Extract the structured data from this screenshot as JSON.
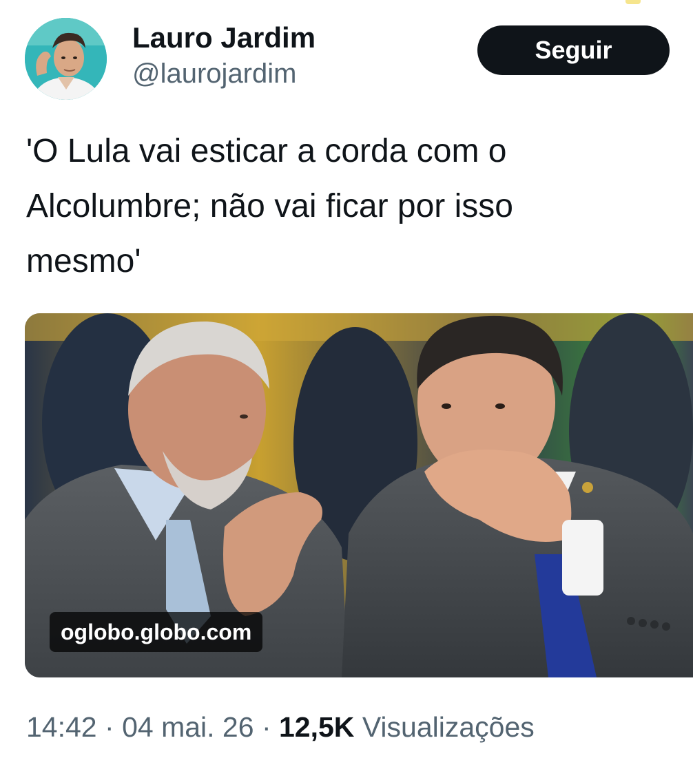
{
  "author": {
    "display_name": "Lauro Jardim",
    "handle": "@laurojardim",
    "follow_label": "Seguir"
  },
  "tweet": {
    "text": "'O Lula vai esticar a corda com o\nAlcolumbre; não vai ficar por isso\nmesmo'"
  },
  "media": {
    "link_domain": "oglobo.globo.com"
  },
  "meta": {
    "time": "14:42",
    "separator": "·",
    "date": "04 mai. 26",
    "views_count": "12,5K",
    "views_label": "Visualizações"
  },
  "colors": {
    "text_primary": "#0f1419",
    "text_secondary": "#536471",
    "follow_bg": "#0f1419",
    "follow_text": "#ffffff"
  }
}
